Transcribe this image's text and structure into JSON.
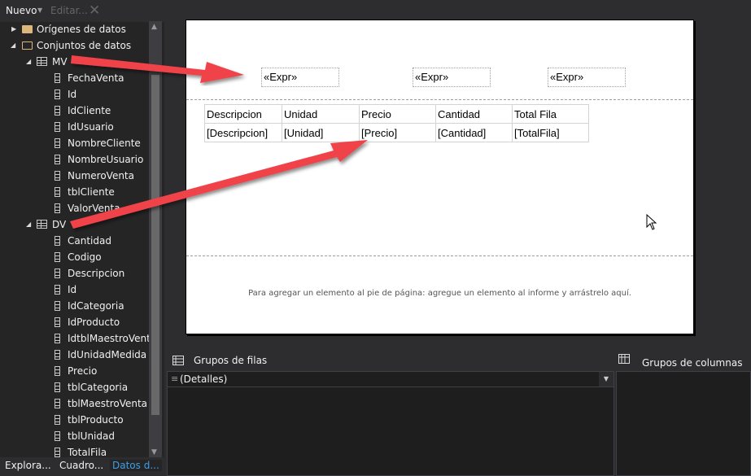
{
  "toolbar": {
    "new_label": "Nuevo",
    "edit_label": "Editar..."
  },
  "tree": {
    "data_sources": "Orígenes de datos",
    "datasets": "Conjuntos de datos",
    "mv": {
      "name": "MV",
      "fields": [
        "FechaVenta",
        "Id",
        "IdCliente",
        "IdUsuario",
        "NombreCliente",
        "NombreUsuario",
        "NumeroVenta",
        "tblCliente",
        "ValorVenta"
      ]
    },
    "dv": {
      "name": "DV",
      "fields": [
        "Cantidad",
        "Codigo",
        "Descripcion",
        "Id",
        "IdCategoria",
        "IdProducto",
        "IdtblMaestroVenta",
        "IdUnidadMedida",
        "Precio",
        "tblCategoria",
        "tblMaestroVenta",
        "tblProducto",
        "tblUnidad",
        "TotalFila"
      ]
    }
  },
  "tabs": [
    "Explora...",
    "Cuadro...",
    "Datos d..."
  ],
  "report": {
    "header_exprs": [
      "«Expr»",
      "«Expr»",
      "«Expr»"
    ],
    "table_headers": [
      "Descripcion",
      "Unidad",
      "Precio",
      "Cantidad",
      "Total Fila"
    ],
    "table_values": [
      "[Descripcion]",
      "[Unidad]",
      "[Precio]",
      "[Cantidad]",
      "[TotalFila]"
    ],
    "footer_hint": "Para agregar un elemento al pie de página: agregue un elemento al informe y arrástrelo aquí."
  },
  "groups": {
    "row_title": "Grupos de filas",
    "col_title": "Grupos de columnas",
    "row_item": "(Detalles)"
  },
  "colors": {
    "arrow": "#f04248",
    "active_tab": "#3e9ee6",
    "folder": "#dcb67a"
  }
}
